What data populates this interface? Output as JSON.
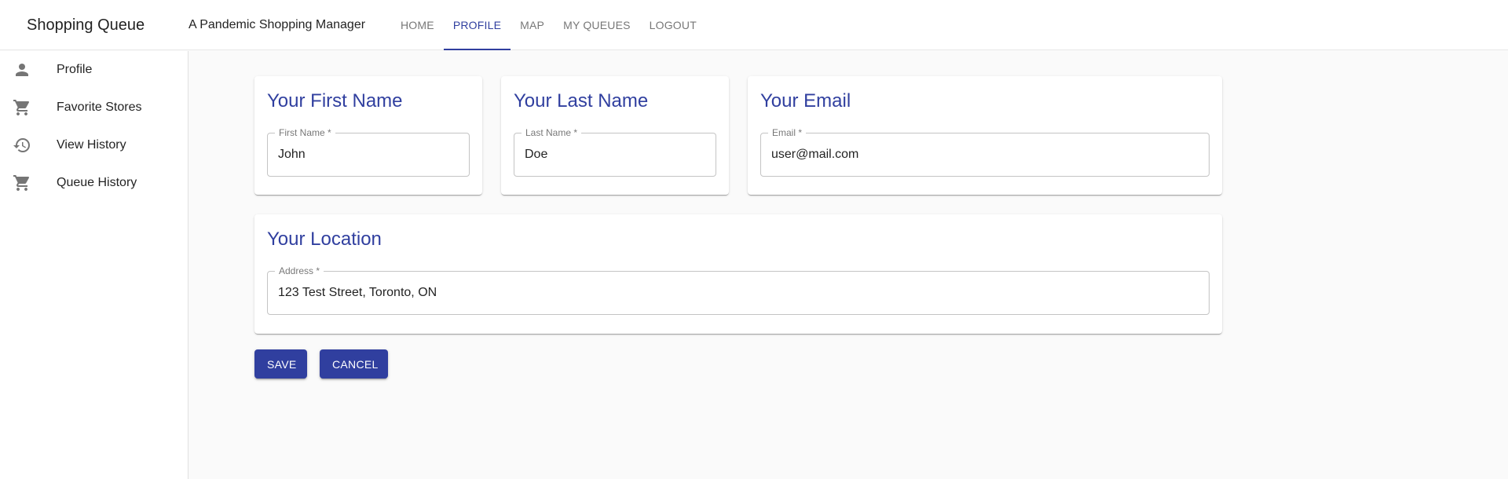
{
  "app": {
    "title": "Shopping Queue",
    "subtitle": "A Pandemic Shopping Manager"
  },
  "nav": {
    "tabs": [
      {
        "label": "HOME"
      },
      {
        "label": "PROFILE",
        "active": true
      },
      {
        "label": "MAP"
      },
      {
        "label": "MY QUEUES"
      },
      {
        "label": "LOGOUT"
      }
    ]
  },
  "sidebar": {
    "items": [
      {
        "label": "Profile",
        "icon": "person-icon"
      },
      {
        "label": "Favorite Stores",
        "icon": "cart-icon"
      },
      {
        "label": "View History",
        "icon": "history-icon"
      },
      {
        "label": "Queue History",
        "icon": "cart-icon"
      }
    ]
  },
  "profile": {
    "first_name": {
      "title": "Your First Name",
      "label": "First Name *",
      "value": "John"
    },
    "last_name": {
      "title": "Your Last Name",
      "label": "Last Name *",
      "value": "Doe"
    },
    "email": {
      "title": "Your Email",
      "label": "Email *",
      "value": "user@mail.com"
    },
    "location": {
      "title": "Your Location",
      "label": "Address *",
      "value": "123 Test Street, Toronto, ON"
    }
  },
  "actions": {
    "save_label": "SAVE",
    "cancel_label": "CANCEL"
  },
  "colors": {
    "accent": "#303f9f",
    "background": "#fafafa",
    "surface": "#ffffff"
  }
}
